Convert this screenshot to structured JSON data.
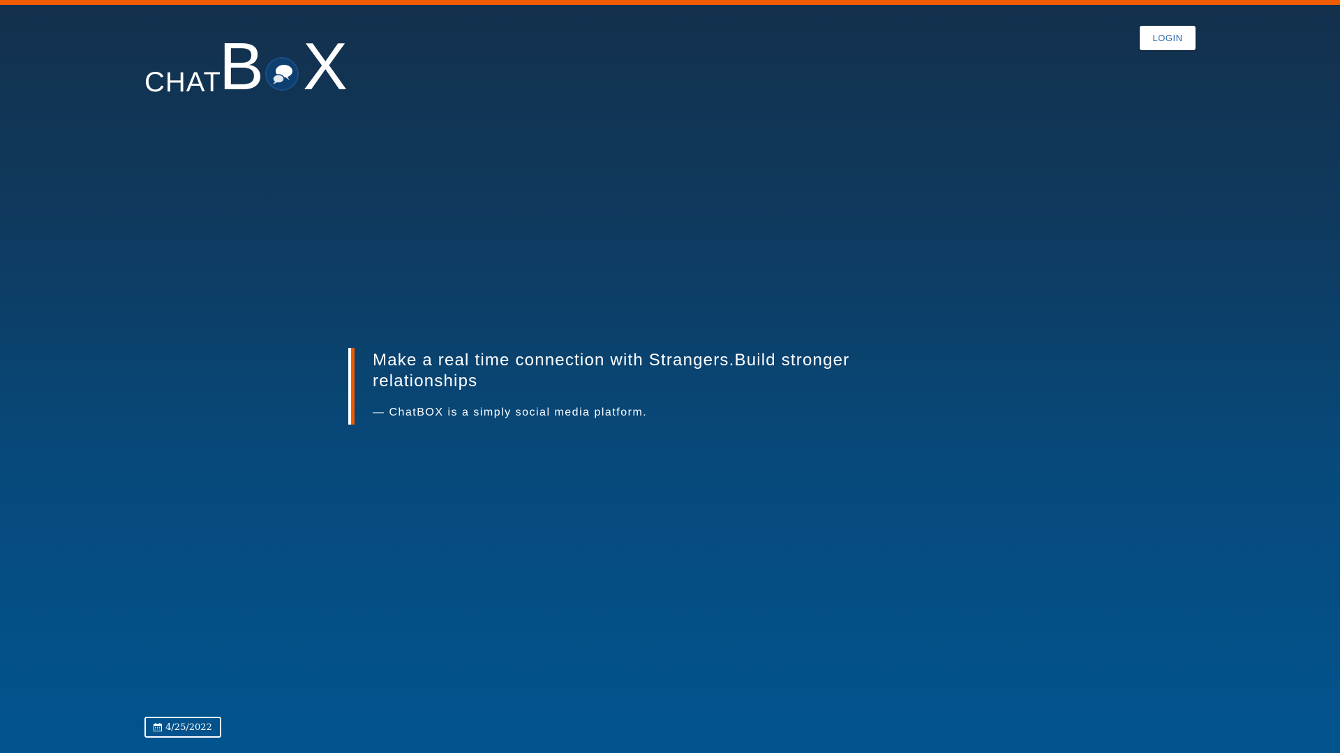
{
  "header": {
    "logo": {
      "part1": "CHAT",
      "part2": "B",
      "part3": "X",
      "icon": "chat-bubbles-icon"
    },
    "login_label": "LOGIN"
  },
  "hero": {
    "quote": "Make a real time connection with Strangers.Build stronger relationships",
    "attribution": "— ChatBOX is a simply social media platform."
  },
  "footer": {
    "date": "4/25/2022",
    "date_icon": "calendar-icon"
  },
  "colors": {
    "accent": "#f05a00",
    "background_top": "#13304c",
    "background_bottom": "#02548f",
    "button_text": "#2a6aa8"
  }
}
